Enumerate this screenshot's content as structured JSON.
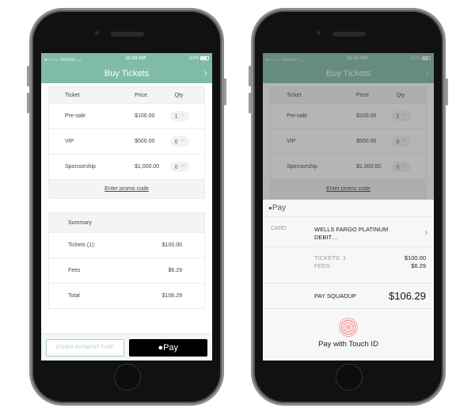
{
  "status_bar": {
    "carrier": "●○○○○ Verizon",
    "wifi_icon": "wifi-icon",
    "time": "11:43 AM",
    "battery": "83%"
  },
  "nav": {
    "title": "Buy Tickets",
    "chevron": "›"
  },
  "tickets": {
    "headers": {
      "ticket": "Ticket",
      "price": "Price",
      "qty": "Qty"
    },
    "rows": [
      {
        "name": "Pre-sale",
        "price": "$100.00",
        "qty": "1"
      },
      {
        "name": "VIP",
        "price": "$500.00",
        "qty": "0"
      },
      {
        "name": "Sponsorship",
        "price": "$1,000.00",
        "qty": "0"
      }
    ],
    "promo_link": "Enter promo code"
  },
  "summary": {
    "title": "Summary",
    "rows": [
      {
        "label": "Tickets (1):",
        "value": "$100.00"
      },
      {
        "label": "Fees",
        "value": "$6.29"
      },
      {
        "label": "Total",
        "value": "$106.29"
      }
    ]
  },
  "footer": {
    "other_payment": "OTHER PAYMENT TYPE",
    "apple_pay": " Pay"
  },
  "apple_pay_sheet": {
    "header": " Pay",
    "card_label": "CARD",
    "card_value_line1": "WELLS FARGO PLATINUM",
    "card_value_line2": "DEBIT…",
    "tickets_label": "TICKETS: 1",
    "tickets_value": "$100.00",
    "fees_label": "FEES",
    "fees_value": "$6.29",
    "pay_label": "PAY SQUADUP",
    "pay_amount": "$106.29",
    "touch_id_label": "Pay with Touch ID"
  },
  "colors": {
    "accent": "#80bba8",
    "link_blue": "#2b7ef2",
    "fingerprint": "#ef9aa0"
  }
}
